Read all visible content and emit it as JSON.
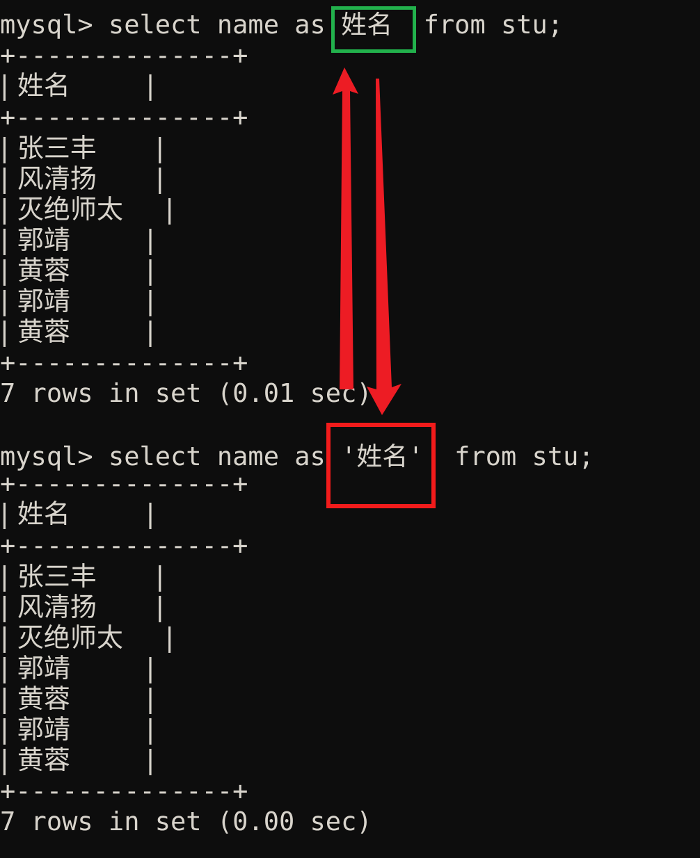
{
  "terminal": {
    "background_color": "#0d0d0d",
    "text_color": "#d8d4cc",
    "prompt": "mysql>",
    "blocks": [
      {
        "id": "query-1",
        "command_prefix": "mysql> select name as ",
        "alias": "姓名",
        "command_suffix": "  from stu;",
        "full_command": "mysql> select name as 姓名  from stu;",
        "border_top": "+--------------+",
        "header_row": "| 姓名         |",
        "header_label": "姓名",
        "border_middle": "+--------------+",
        "rows": [
          "| 张三丰       |",
          "| 风清扬       |",
          "| 灭绝师太     |",
          "| 郭靖         |",
          "| 黄蓉         |",
          "| 郭靖         |",
          "| 黄蓉         |"
        ],
        "values": [
          "张三丰",
          "风清扬",
          "灭绝师太",
          "郭靖",
          "黄蓉",
          "郭靖",
          "黄蓉"
        ],
        "border_bottom": "+--------------+",
        "result_status": "7 rows in set (0.01 sec)",
        "row_count": 7,
        "elapsed": "0.01 sec"
      },
      {
        "id": "query-2",
        "command_prefix": "mysql> select name as ",
        "alias": "'姓名'",
        "command_suffix": "  from stu;",
        "full_command": "mysql> select name as '姓名'  from stu;",
        "border_top": "+--------------+",
        "header_row": "| 姓名         |",
        "header_label": "姓名",
        "border_middle": "+--------------+",
        "rows": [
          "| 张三丰       |",
          "| 风清扬       |",
          "| 灭绝师太     |",
          "| 郭靖         |",
          "| 黄蓉         |",
          "| 郭靖         |",
          "| 黄蓉         |"
        ],
        "values": [
          "张三丰",
          "风清扬",
          "灭绝师太",
          "郭靖",
          "黄蓉",
          "郭靖",
          "黄蓉"
        ],
        "border_bottom": "+--------------+",
        "result_status": "7 rows in set (0.00 sec)",
        "row_count": 7,
        "elapsed": "0.00 sec"
      }
    ]
  },
  "annotations": {
    "highlight_alias_plain": {
      "label": "姓名",
      "color": "#22b14c",
      "shape": "rectangle"
    },
    "highlight_alias_quoted": {
      "label": "'姓名'",
      "color": "#f21b1b",
      "shape": "rectangle"
    },
    "arrow_up": {
      "color": "#ed1c24",
      "direction": "up"
    },
    "arrow_down": {
      "color": "#ed1c24",
      "direction": "down"
    }
  }
}
